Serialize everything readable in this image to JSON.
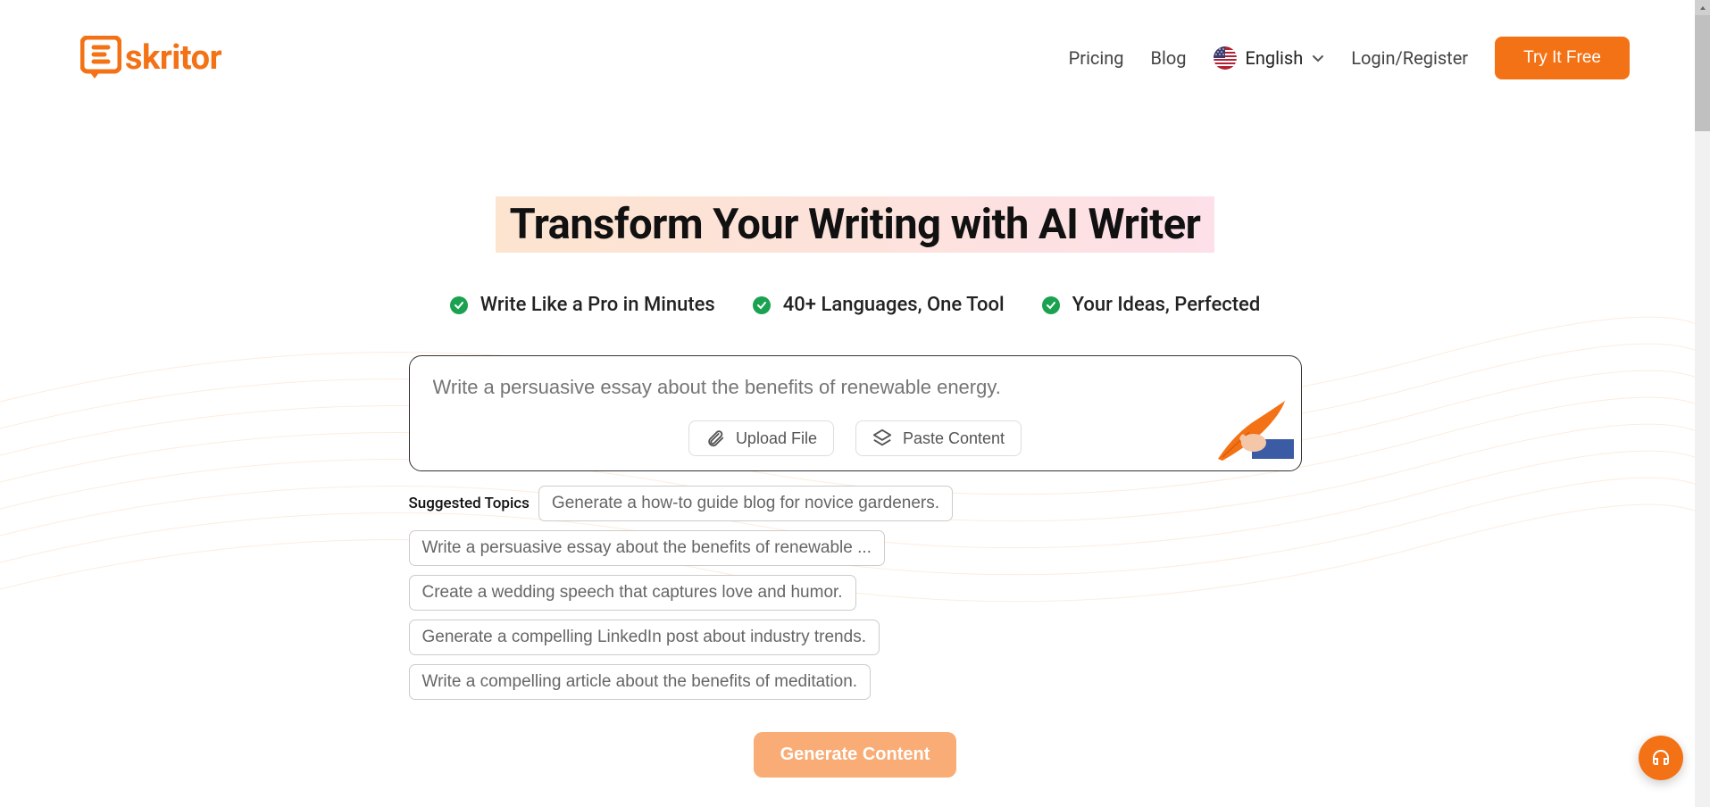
{
  "brand": {
    "name": "skritor"
  },
  "nav": {
    "pricing": "Pricing",
    "blog": "Blog",
    "language": "English",
    "login": "Login/Register",
    "cta": "Try It Free"
  },
  "hero": {
    "headline": "Transform Your Writing with AI Writer",
    "features": [
      "Write Like a Pro in Minutes",
      "40+ Languages, One Tool",
      "Your Ideas, Perfected"
    ]
  },
  "prompt": {
    "placeholder": "Write a persuasive essay about the benefits of renewable energy.",
    "upload": "Upload File",
    "paste": "Paste Content"
  },
  "topics": {
    "label": "Suggested Topics",
    "items": [
      "Generate a how-to guide blog for novice gardeners.",
      "Write a persuasive essay about the benefits of renewable ...",
      "Create a wedding speech that captures love and humor.",
      "Generate a compelling LinkedIn post about industry trends.",
      "Write a compelling article about the benefits of meditation."
    ]
  },
  "generate": "Generate Content",
  "colors": {
    "primary": "#F47216",
    "green": "#1AA251"
  }
}
